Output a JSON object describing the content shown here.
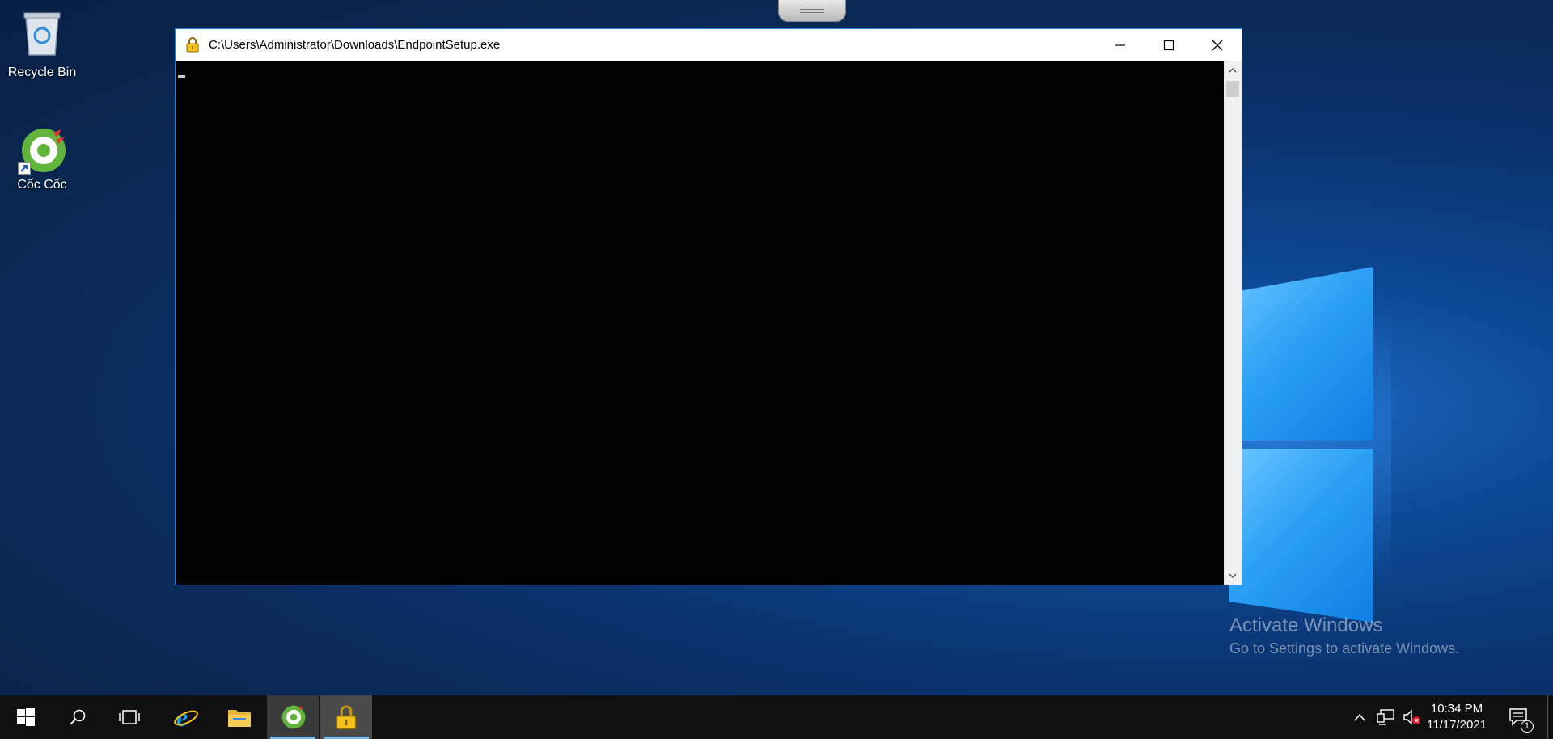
{
  "desktop": {
    "icons": [
      {
        "label": "Recycle Bin"
      },
      {
        "label": "Cốc Cốc"
      }
    ],
    "watermark": {
      "line1": "Activate Windows",
      "line2": "Go to Settings to activate Windows."
    }
  },
  "window": {
    "title": "C:\\Users\\Administrator\\Downloads\\EndpointSetup.exe",
    "icon": "padlock-icon",
    "console_text": ""
  },
  "taskbar": {
    "items": [
      {
        "name": "start-button",
        "icon": "windows-logo-icon"
      },
      {
        "name": "search-button",
        "icon": "search-icon"
      },
      {
        "name": "task-view-button",
        "icon": "task-view-icon"
      },
      {
        "name": "internet-explorer",
        "icon": "internet-explorer-icon"
      },
      {
        "name": "file-explorer",
        "icon": "folder-icon"
      },
      {
        "name": "coc-coc-browser",
        "icon": "coccoc-icon"
      },
      {
        "name": "endpoint-setup",
        "icon": "padlock-icon"
      }
    ],
    "tray": {
      "time": "10:34 PM",
      "date": "11/17/2021",
      "notification_count": "1"
    }
  },
  "colors": {
    "taskbar_bg": "#101010",
    "window_border": "#2a7fd4",
    "accent": "#76b9ed"
  }
}
